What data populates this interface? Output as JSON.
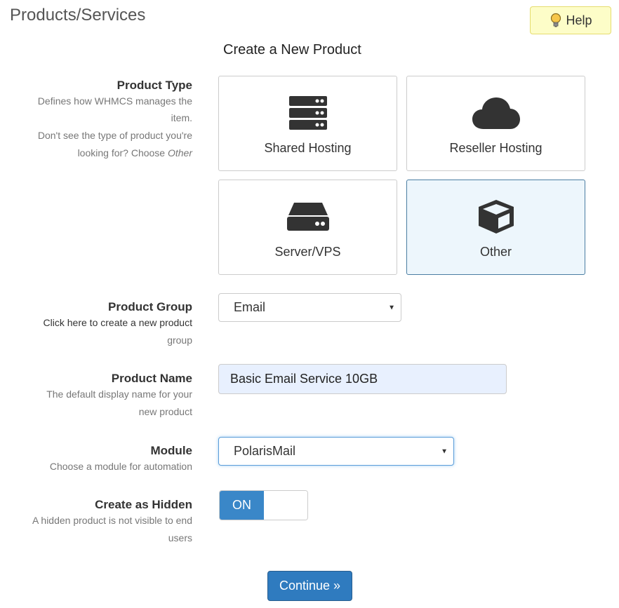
{
  "header": {
    "title": "Products/Services",
    "help_label": "Help",
    "help_icon": "lightbulb-icon"
  },
  "form": {
    "title": "Create a New Product",
    "product_type": {
      "label": "Product Type",
      "help_line1": "Defines how WHMCS manages the",
      "help_line2": "item.",
      "help_line3": "Don't see the type of product you're",
      "help_line4_prefix": "looking for? Choose ",
      "help_line4_em": "Other",
      "options": [
        {
          "label": "Shared Hosting",
          "icon": "server-stack-icon",
          "selected": false
        },
        {
          "label": "Reseller Hosting",
          "icon": "cloud-icon",
          "selected": false
        },
        {
          "label": "Server/VPS",
          "icon": "hard-drive-icon",
          "selected": false
        },
        {
          "label": "Other",
          "icon": "cube-icon",
          "selected": true
        }
      ]
    },
    "product_group": {
      "label": "Product Group",
      "help_line1": "Click here to create a new product",
      "help_line2": "group",
      "value": "Email"
    },
    "product_name": {
      "label": "Product Name",
      "help_line1": "The default display name for your",
      "help_line2": "new product",
      "value": "Basic Email Service 10GB"
    },
    "module": {
      "label": "Module",
      "help_line1": "Choose a module for automation",
      "value": "PolarisMail"
    },
    "hidden": {
      "label": "Create as Hidden",
      "help_line1": "A hidden product is not visible to end",
      "help_line2": "users",
      "state": "ON"
    },
    "continue_label": "Continue »"
  },
  "colors": {
    "accent": "#3a87c8",
    "selected_card_bg": "#edf6fc",
    "help_bg": "#fdfdc8"
  }
}
